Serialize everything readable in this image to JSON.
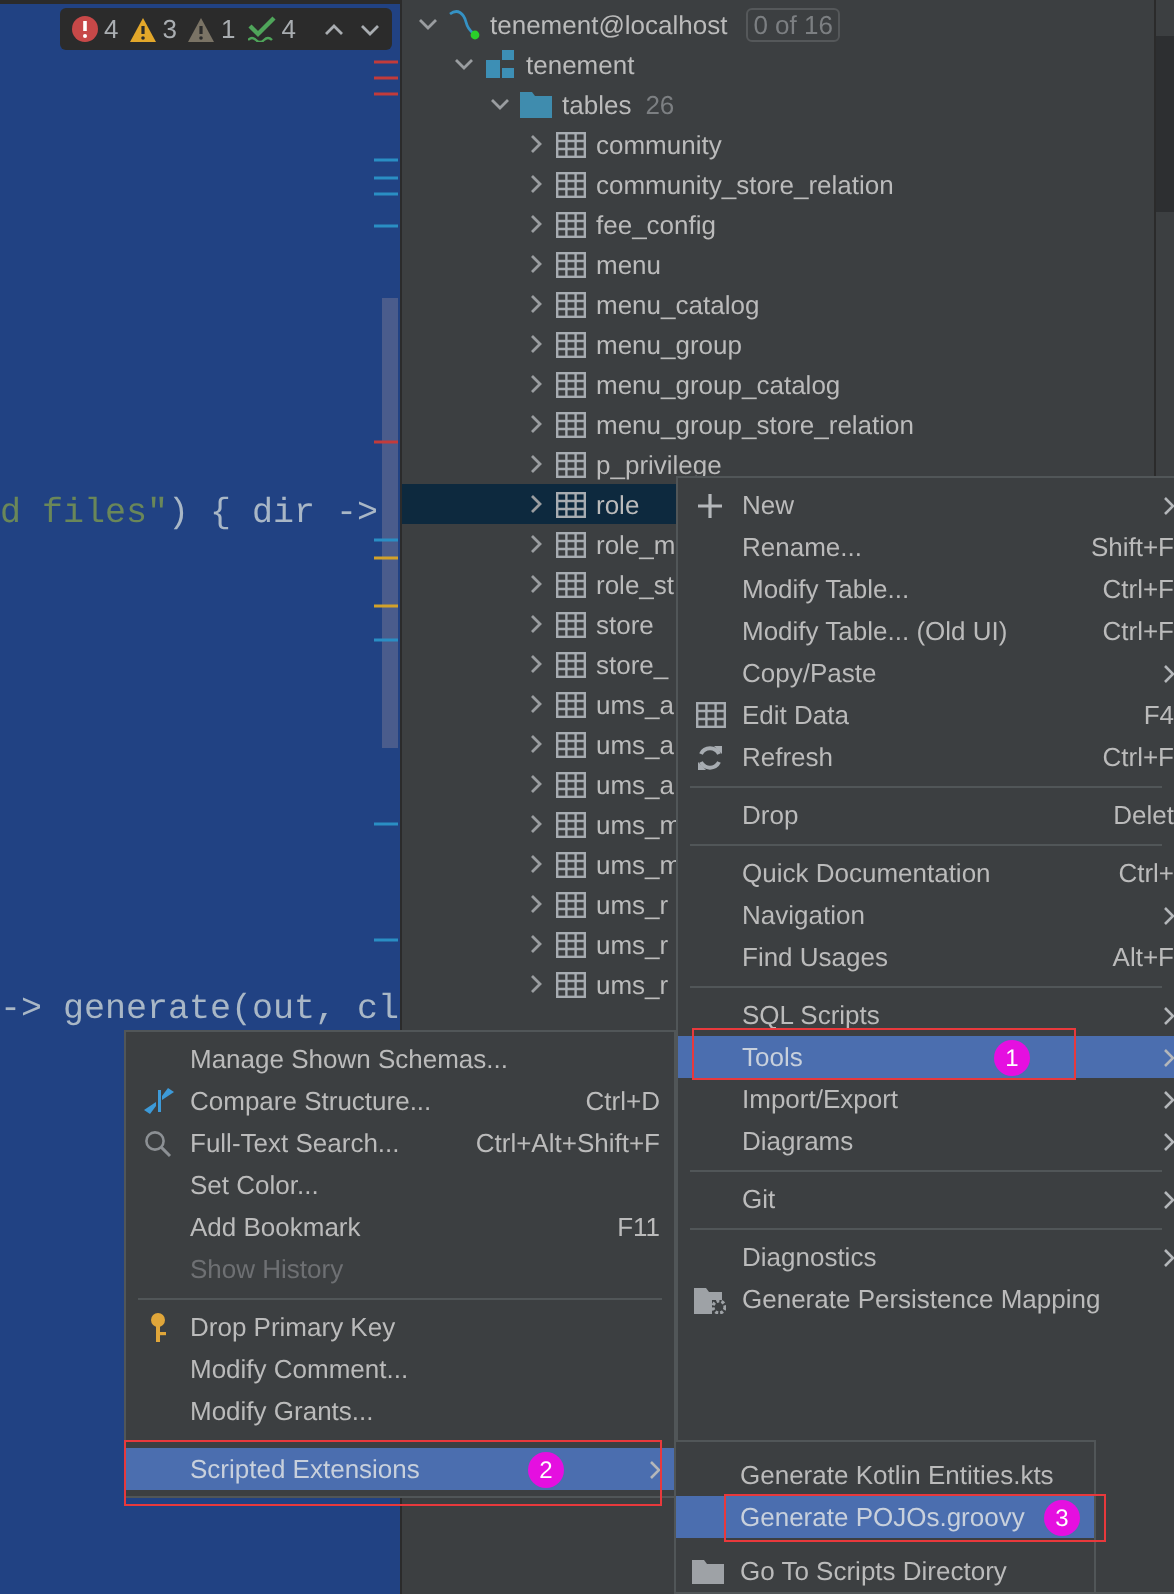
{
  "editor": {
    "inspections": [
      {
        "kind": "error",
        "count": "4"
      },
      {
        "kind": "warning",
        "count": "3"
      },
      {
        "kind": "weak_warning",
        "count": "1"
      },
      {
        "kind": "typo",
        "count": "4"
      }
    ],
    "code_lines": [
      [
        {
          "kind": "string",
          "text": "d files\""
        },
        {
          "kind": "plain",
          "text": ") { dir ->"
        }
      ],
      [
        {
          "kind": "plain",
          "text": "-> generate(out, cl"
        }
      ]
    ]
  },
  "database_tree": {
    "nodes": [
      {
        "kind": "connection",
        "label": "tenement@localhost",
        "badge": "0 of 16",
        "expanded": true,
        "selected": false,
        "children": [
          {
            "kind": "schema",
            "label": "tenement",
            "expanded": true,
            "selected": false,
            "children": [
              {
                "kind": "folder",
                "label": "tables",
                "count": "26",
                "expanded": true,
                "selected": false,
                "children": [
                  {
                    "kind": "table",
                    "label": "community",
                    "expanded": false,
                    "selected": false
                  },
                  {
                    "kind": "table",
                    "label": "community_store_relation",
                    "expanded": false,
                    "selected": false
                  },
                  {
                    "kind": "table",
                    "label": "fee_config",
                    "expanded": false,
                    "selected": false
                  },
                  {
                    "kind": "table",
                    "label": "menu",
                    "expanded": false,
                    "selected": false
                  },
                  {
                    "kind": "table",
                    "label": "menu_catalog",
                    "expanded": false,
                    "selected": false
                  },
                  {
                    "kind": "table",
                    "label": "menu_group",
                    "expanded": false,
                    "selected": false
                  },
                  {
                    "kind": "table",
                    "label": "menu_group_catalog",
                    "expanded": false,
                    "selected": false
                  },
                  {
                    "kind": "table",
                    "label": "menu_group_store_relation",
                    "expanded": false,
                    "selected": false
                  },
                  {
                    "kind": "table",
                    "label": "p_privilege",
                    "expanded": false,
                    "selected": false
                  },
                  {
                    "kind": "table",
                    "label": "role",
                    "expanded": false,
                    "selected": true
                  },
                  {
                    "kind": "table",
                    "label": "role_m",
                    "expanded": false,
                    "selected": false
                  },
                  {
                    "kind": "table",
                    "label": "role_st",
                    "expanded": false,
                    "selected": false
                  },
                  {
                    "kind": "table",
                    "label": "store",
                    "expanded": false,
                    "selected": false
                  },
                  {
                    "kind": "table",
                    "label": "store_",
                    "expanded": false,
                    "selected": false
                  },
                  {
                    "kind": "table",
                    "label": "ums_a",
                    "expanded": false,
                    "selected": false
                  },
                  {
                    "kind": "table",
                    "label": "ums_a",
                    "expanded": false,
                    "selected": false
                  },
                  {
                    "kind": "table",
                    "label": "ums_a",
                    "expanded": false,
                    "selected": false
                  },
                  {
                    "kind": "table",
                    "label": "ums_m",
                    "expanded": false,
                    "selected": false
                  },
                  {
                    "kind": "table",
                    "label": "ums_m",
                    "expanded": false,
                    "selected": false
                  },
                  {
                    "kind": "table",
                    "label": "ums_r",
                    "expanded": false,
                    "selected": false
                  },
                  {
                    "kind": "table",
                    "label": "ums_r",
                    "expanded": false,
                    "selected": false
                  },
                  {
                    "kind": "table",
                    "label": "ums_r",
                    "expanded": false,
                    "selected": false
                  }
                ]
              }
            ]
          }
        ]
      }
    ]
  },
  "context_menu": {
    "items": [
      {
        "kind": "item",
        "label": "New",
        "has_submenu": true,
        "selected": false,
        "disabled": false
      },
      {
        "kind": "item",
        "label": "Rename...",
        "shortcut": "Shift+F",
        "selected": false,
        "disabled": false
      },
      {
        "kind": "item",
        "label": "Modify Table...",
        "shortcut": "Ctrl+F",
        "selected": false,
        "disabled": false
      },
      {
        "kind": "item",
        "label": "Modify Table... (Old UI)",
        "shortcut": "Ctrl+F",
        "selected": false,
        "disabled": false
      },
      {
        "kind": "item",
        "label": "Copy/Paste",
        "has_submenu": true,
        "selected": false,
        "disabled": false
      },
      {
        "kind": "item",
        "label": "Edit Data",
        "shortcut": "F4",
        "selected": false,
        "disabled": false
      },
      {
        "kind": "item",
        "label": "Refresh",
        "shortcut": "Ctrl+F",
        "selected": false,
        "disabled": false
      },
      {
        "kind": "separator"
      },
      {
        "kind": "item",
        "label": "Drop",
        "shortcut": "Delet",
        "selected": false,
        "disabled": false
      },
      {
        "kind": "separator"
      },
      {
        "kind": "item",
        "label": "Quick Documentation",
        "shortcut": "Ctrl+",
        "selected": false,
        "disabled": false
      },
      {
        "kind": "item",
        "label": "Navigation",
        "has_submenu": true,
        "selected": false,
        "disabled": false
      },
      {
        "kind": "item",
        "label": "Find Usages",
        "shortcut": "Alt+F",
        "selected": false,
        "disabled": false
      },
      {
        "kind": "separator"
      },
      {
        "kind": "item",
        "label": "SQL Scripts",
        "has_submenu": true,
        "selected": false,
        "disabled": false
      },
      {
        "kind": "item",
        "label": "Tools",
        "has_submenu": true,
        "selected": true,
        "disabled": false,
        "callout": "1"
      },
      {
        "kind": "item",
        "label": "Import/Export",
        "has_submenu": true,
        "selected": false,
        "disabled": false
      },
      {
        "kind": "item",
        "label": "Diagrams",
        "has_submenu": true,
        "selected": false,
        "disabled": false
      },
      {
        "kind": "separator"
      },
      {
        "kind": "item",
        "label": "Git",
        "has_submenu": true,
        "selected": false,
        "disabled": false
      },
      {
        "kind": "separator"
      },
      {
        "kind": "item",
        "label": "Diagnostics",
        "has_submenu": true,
        "selected": false,
        "disabled": false
      },
      {
        "kind": "item",
        "label": "Generate Persistence Mapping",
        "selected": false,
        "disabled": false
      }
    ]
  },
  "tools_menu": {
    "items": [
      {
        "kind": "item",
        "label": "Manage Shown Schemas...",
        "selected": false,
        "disabled": false
      },
      {
        "kind": "item",
        "label": "Compare Structure...",
        "shortcut": "Ctrl+D",
        "selected": false,
        "disabled": false
      },
      {
        "kind": "item",
        "label": "Full-Text Search...",
        "shortcut": "Ctrl+Alt+Shift+F",
        "selected": false,
        "disabled": false
      },
      {
        "kind": "item",
        "label": "Set Color...",
        "selected": false,
        "disabled": false
      },
      {
        "kind": "item",
        "label": "Add Bookmark",
        "shortcut": "F11",
        "selected": false,
        "disabled": false
      },
      {
        "kind": "item",
        "label": "Show History",
        "selected": false,
        "disabled": true
      },
      {
        "kind": "separator"
      },
      {
        "kind": "item",
        "label": "Drop Primary Key",
        "selected": false,
        "disabled": false
      },
      {
        "kind": "item",
        "label": "Modify Comment...",
        "selected": false,
        "disabled": false
      },
      {
        "kind": "item",
        "label": "Modify Grants...",
        "selected": false,
        "disabled": false
      },
      {
        "kind": "separator"
      },
      {
        "kind": "item",
        "label": "Scripted Extensions",
        "has_submenu": true,
        "selected": true,
        "disabled": false,
        "callout": "2"
      }
    ]
  },
  "scripts_menu": {
    "items": [
      {
        "kind": "item",
        "label": "Generate Kotlin Entities.kts",
        "selected": false,
        "disabled": false
      },
      {
        "kind": "item",
        "label": "Generate POJOs.groovy",
        "selected": true,
        "disabled": false,
        "callout": "3"
      },
      {
        "kind": "separator"
      },
      {
        "kind": "item",
        "label": "Go To Scripts Directory",
        "selected": false,
        "disabled": false
      }
    ]
  }
}
